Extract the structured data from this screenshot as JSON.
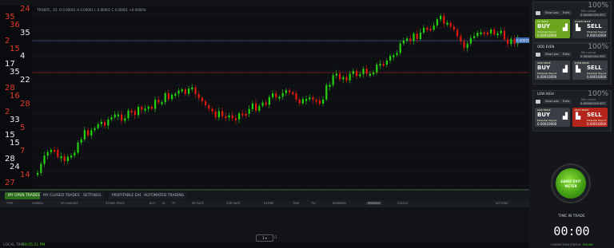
{
  "top_bar": {
    "title_right": "100%"
  },
  "left_numbers": [
    {
      "t": "24",
      "c": "#e03b2c"
    },
    {
      "t": "35",
      "c": "#e03b2c"
    },
    {
      "t": "36",
      "c": "#e03b2c"
    },
    {
      "t": "35",
      "c": "#f0f0f0"
    },
    {
      "t": "2",
      "c": "#e03b2c"
    },
    {
      "t": "15",
      "c": "#e03b2c"
    },
    {
      "t": "4",
      "c": "#f0f0f0"
    },
    {
      "t": "17",
      "c": "#f0f0f0"
    },
    {
      "t": "35",
      "c": "#f0f0f0"
    },
    {
      "t": "22",
      "c": "#f0f0f0"
    },
    {
      "t": "28",
      "c": "#e03b2c"
    },
    {
      "t": "16",
      "c": "#e03b2c"
    },
    {
      "t": "28",
      "c": "#e03b2c"
    },
    {
      "t": "2",
      "c": "#e03b2c"
    },
    {
      "t": "33",
      "c": "#f0f0f0"
    },
    {
      "t": "5",
      "c": "#e03b2c"
    },
    {
      "t": "15",
      "c": "#f0f0f0"
    },
    {
      "t": "15",
      "c": "#f0f0f0"
    },
    {
      "t": "7",
      "c": "#e03b2c"
    },
    {
      "t": "28",
      "c": "#f0f0f0"
    },
    {
      "t": "24",
      "c": "#f0f0f0"
    },
    {
      "t": "14",
      "c": "#e03b2c"
    },
    {
      "t": "27",
      "c": "#e03b2c"
    }
  ],
  "chart": {
    "ohlc_text": "TRX/BTC, 1D: O 0.00001 H 0.00001 L 0.00001 C 0.00001 +0.0000%",
    "up_color": "#25d30f",
    "down_color": "#e01a0e",
    "price_line_color": "#5b7fb5",
    "strike_line_color": "#c5241a",
    "price_tag": "0.00001",
    "grid": true
  },
  "tabs": [
    {
      "label": "MY OPEN TRADES",
      "active": true
    },
    {
      "label": "MY CLOSED TRADES",
      "active": false
    },
    {
      "label": "SETTINGS",
      "active": false
    },
    {
      "label": "PROFITABLE EARNINGS",
      "active": false
    },
    {
      "label": "AUTOMATED TRADING",
      "active": false
    }
  ],
  "table_headers": [
    "TYPE",
    "SYMBOL",
    "MY AMOUNT",
    "STRIKE PRICE",
    "BUY",
    "SL",
    "TP",
    "MY RATE",
    "CUR RATE",
    "EXPIRE",
    "TIME",
    "P/L",
    "REMARKS",
    "PERCENT",
    "STATUS",
    "ACTIONS"
  ],
  "pager": {
    "value": "1",
    "label": "/1"
  },
  "status_bar": {
    "label": "LOCAL TIME:",
    "time": "19:05:21 PM"
  },
  "panels": [
    {
      "title": "",
      "pct": "100%",
      "ctrl1": "Stop Loss",
      "ctrl2": "Exits",
      "amount_label": "Min value",
      "amount_value": "0.00000100 BTC",
      "buy": {
        "label": "BUY",
        "sub1": "Potential Payout",
        "sub2": "0.00010000",
        "head": "UP PRICE"
      },
      "sell": {
        "label": "SELL",
        "sub1": "Potential Payout",
        "sub2": "0.00010000",
        "head": "DOWN PRICE"
      }
    },
    {
      "title": "ODD   EVEN",
      "pct": "100%",
      "ctrl1": "Stop Loss",
      "ctrl2": "Exits",
      "amount_label": "Min value",
      "amount_value": "0.00000100 BTC",
      "buy": {
        "label": "BUY",
        "sub1": "Potential Payout",
        "sub2": "0.00010000",
        "head": "ODD PRICE"
      },
      "sell": {
        "label": "SELL",
        "sub1": "Potential Payout",
        "sub2": "0.00010000",
        "head": "EVEN PRICE"
      }
    },
    {
      "title": "LOW   HIGH",
      "pct": "100%",
      "ctrl1": "Stop Loss",
      "ctrl2": "Exits",
      "amount_label": "Min value",
      "amount_value": "0.00000100 BTC",
      "buy": {
        "label": "BUY",
        "sub1": "Potential Payout",
        "sub2": "0.00010000",
        "head": "LOW PRICE"
      },
      "sell": {
        "label": "SELL",
        "sub1": "Potential Payout",
        "sub2": "0.00010000",
        "head": "HIGH PRICE"
      }
    }
  ],
  "early_exit": {
    "line1": "EARLY EXIT",
    "line2": "METER"
  },
  "time_in_trade": {
    "label": "TIME IN TRADE",
    "value": "00:00"
  },
  "connection": {
    "label": "CONNECTION STATUS:",
    "value": "ONLINE"
  }
}
